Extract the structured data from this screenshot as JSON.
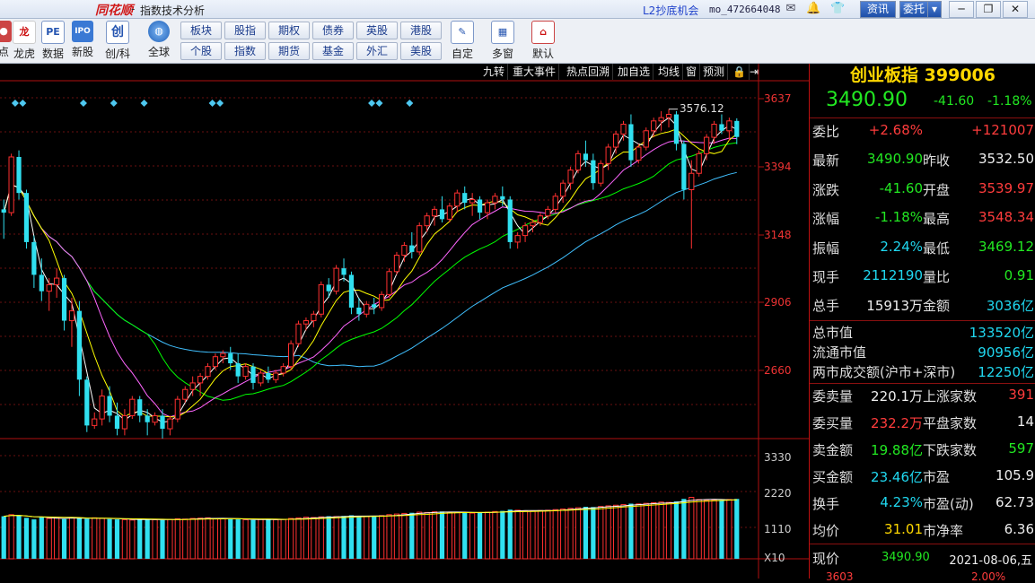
{
  "titlebar": {
    "logo": "同花顺",
    "separator": "-",
    "title": "指数技术分析",
    "promo": "L2抄底机会",
    "user": "mo_472664048",
    "news_btn": "资讯",
    "trade_btn": "委托",
    "trade_arrow": "▾"
  },
  "toolbar": {
    "items": [
      {
        "label": "点",
        "icon": "dot-icon"
      },
      {
        "label": "龙虎",
        "icon": "dragon-tiger-icon"
      },
      {
        "label": "数据",
        "icon": "data-icon",
        "glyph": "PE"
      },
      {
        "label": "新股",
        "icon": "ipo-icon",
        "glyph": "IPO"
      },
      {
        "label": "创/科",
        "icon": "chuang-ke-icon",
        "glyph": "创"
      },
      {
        "label": "全球",
        "icon": "globe-icon"
      },
      {
        "label": "自定",
        "icon": "custom-icon"
      },
      {
        "label": "多窗",
        "icon": "multi-window-icon"
      },
      {
        "label": "默认",
        "icon": "home-icon"
      }
    ],
    "market_buttons": [
      [
        "板块",
        "股指",
        "期权",
        "债券",
        "英股",
        "港股"
      ],
      [
        "个股",
        "指数",
        "期货",
        "基金",
        "外汇",
        "美股"
      ]
    ]
  },
  "chart": {
    "tabs": [
      "九转",
      "重大事件",
      "热点回溯",
      "加自选",
      "均线",
      "窗",
      "预测"
    ],
    "peak_label": "3576.12",
    "price_axis": [
      "3637",
      "3394",
      "3148",
      "2906",
      "2660"
    ],
    "volume_axis": [
      "3330",
      "2220",
      "1110",
      "X10"
    ],
    "colors": {
      "up": "#ff3030",
      "down": "#30e0f0",
      "ma5": "#ffffff",
      "ma10": "#ffff00",
      "ma20": "#ff66ff",
      "ma30": "#00ff00",
      "ma60": "#40c0ff"
    }
  },
  "chart_data": {
    "type": "candlestick",
    "title": "",
    "ylim": [
      2570,
      3660
    ],
    "candles": [
      [
        3270,
        3300,
        3180,
        3260
      ],
      [
        3260,
        3440,
        3250,
        3430
      ],
      [
        3430,
        3450,
        3300,
        3320
      ],
      [
        3320,
        3330,
        3150,
        3170
      ],
      [
        3170,
        3190,
        3030,
        3070
      ],
      [
        3070,
        3120,
        2990,
        3020
      ],
      [
        3020,
        3060,
        2960,
        3040
      ],
      [
        3040,
        3090,
        3000,
        3060
      ],
      [
        3060,
        3070,
        2900,
        2930
      ],
      [
        2930,
        3000,
        2850,
        2960
      ],
      [
        2960,
        2990,
        2700,
        2750
      ],
      [
        2750,
        2760,
        2590,
        2610
      ],
      [
        2610,
        2650,
        2600,
        2630
      ],
      [
        2630,
        2720,
        2610,
        2700
      ],
      [
        2700,
        2730,
        2620,
        2640
      ],
      [
        2640,
        2680,
        2580,
        2600
      ],
      [
        2600,
        2660,
        2580,
        2640
      ],
      [
        2640,
        2700,
        2630,
        2690
      ],
      [
        2690,
        2700,
        2620,
        2640
      ],
      [
        2640,
        2660,
        2580,
        2620
      ],
      [
        2620,
        2650,
        2610,
        2640
      ],
      [
        2640,
        2660,
        2570,
        2600
      ],
      [
        2600,
        2640,
        2580,
        2630
      ],
      [
        2630,
        2700,
        2620,
        2690
      ],
      [
        2690,
        2730,
        2680,
        2720
      ],
      [
        2720,
        2760,
        2700,
        2740
      ],
      [
        2740,
        2770,
        2700,
        2760
      ],
      [
        2760,
        2800,
        2750,
        2790
      ],
      [
        2790,
        2830,
        2780,
        2820
      ],
      [
        2820,
        2840,
        2800,
        2830
      ],
      [
        2830,
        2850,
        2780,
        2800
      ],
      [
        2800,
        2830,
        2740,
        2760
      ],
      [
        2760,
        2800,
        2750,
        2790
      ],
      [
        2790,
        2800,
        2720,
        2740
      ],
      [
        2740,
        2780,
        2730,
        2770
      ],
      [
        2770,
        2790,
        2740,
        2750
      ],
      [
        2750,
        2780,
        2740,
        2770
      ],
      [
        2770,
        2800,
        2760,
        2790
      ],
      [
        2790,
        2870,
        2780,
        2860
      ],
      [
        2860,
        2930,
        2850,
        2920
      ],
      [
        2920,
        2940,
        2900,
        2930
      ],
      [
        2930,
        2960,
        2910,
        2950
      ],
      [
        2950,
        3050,
        2940,
        3040
      ],
      [
        3040,
        3060,
        3000,
        3020
      ],
      [
        3020,
        3100,
        3010,
        3090
      ],
      [
        3090,
        3120,
        3050,
        3070
      ],
      [
        3070,
        3080,
        2950,
        2970
      ],
      [
        2970,
        3000,
        2930,
        2950
      ],
      [
        2950,
        2990,
        2940,
        2980
      ],
      [
        2980,
        3000,
        2950,
        2970
      ],
      [
        2970,
        3020,
        2960,
        3010
      ],
      [
        3010,
        3090,
        3000,
        3080
      ],
      [
        3080,
        3140,
        3070,
        3130
      ],
      [
        3130,
        3170,
        3110,
        3160
      ],
      [
        3160,
        3200,
        3120,
        3140
      ],
      [
        3140,
        3230,
        3130,
        3220
      ],
      [
        3220,
        3260,
        3200,
        3250
      ],
      [
        3250,
        3280,
        3220,
        3270
      ],
      [
        3270,
        3310,
        3230,
        3240
      ],
      [
        3240,
        3290,
        3230,
        3280
      ],
      [
        3280,
        3330,
        3260,
        3320
      ],
      [
        3320,
        3340,
        3270,
        3290
      ],
      [
        3290,
        3320,
        3250,
        3300
      ],
      [
        3300,
        3310,
        3240,
        3260
      ],
      [
        3260,
        3300,
        3240,
        3290
      ],
      [
        3290,
        3320,
        3270,
        3310
      ],
      [
        3310,
        3340,
        3280,
        3300
      ],
      [
        3300,
        3310,
        3150,
        3170
      ],
      [
        3170,
        3200,
        3150,
        3190
      ],
      [
        3190,
        3230,
        3170,
        3220
      ],
      [
        3220,
        3240,
        3200,
        3230
      ],
      [
        3230,
        3260,
        3220,
        3250
      ],
      [
        3250,
        3280,
        3240,
        3270
      ],
      [
        3270,
        3320,
        3260,
        3310
      ],
      [
        3310,
        3360,
        3290,
        3350
      ],
      [
        3350,
        3400,
        3330,
        3390
      ],
      [
        3390,
        3450,
        3380,
        3440
      ],
      [
        3440,
        3480,
        3400,
        3420
      ],
      [
        3420,
        3440,
        3330,
        3350
      ],
      [
        3350,
        3420,
        3340,
        3410
      ],
      [
        3410,
        3470,
        3390,
        3460
      ],
      [
        3460,
        3510,
        3440,
        3500
      ],
      [
        3500,
        3540,
        3480,
        3530
      ],
      [
        3530,
        3560,
        3400,
        3420
      ],
      [
        3420,
        3470,
        3410,
        3460
      ],
      [
        3460,
        3520,
        3450,
        3510
      ],
      [
        3510,
        3550,
        3490,
        3540
      ],
      [
        3540,
        3570,
        3510,
        3550
      ],
      [
        3550,
        3576,
        3520,
        3560
      ],
      [
        3560,
        3570,
        3450,
        3470
      ],
      [
        3470,
        3480,
        3300,
        3330
      ],
      [
        3330,
        3420,
        3150,
        3380
      ],
      [
        3380,
        3450,
        3370,
        3440
      ],
      [
        3440,
        3500,
        3420,
        3490
      ],
      [
        3490,
        3540,
        3470,
        3530
      ],
      [
        3530,
        3560,
        3500,
        3510
      ],
      [
        3510,
        3550,
        3480,
        3540
      ],
      [
        3540,
        3548,
        3469,
        3491
      ]
    ],
    "volume": [
      1350,
      1400,
      1380,
      1300,
      1250,
      1320,
      1280,
      1300,
      1260,
      1310,
      1290,
      1270,
      1300,
      1280,
      1260,
      1250,
      1240,
      1230,
      1260,
      1250,
      1240,
      1230,
      1250,
      1270,
      1260,
      1280,
      1290,
      1300,
      1280,
      1270,
      1260,
      1250,
      1240,
      1230,
      1250,
      1260,
      1240,
      1250,
      1280,
      1300,
      1320,
      1310,
      1330,
      1350,
      1340,
      1360,
      1380,
      1350,
      1340,
      1360,
      1370,
      1400,
      1420,
      1440,
      1460,
      1480,
      1470,
      1490,
      1500,
      1480,
      1470,
      1460,
      1450,
      1470,
      1480,
      1500,
      1520,
      1560,
      1540,
      1520,
      1510,
      1530,
      1540,
      1560,
      1580,
      1600,
      1620,
      1650,
      1640,
      1660,
      1680,
      1700,
      1720,
      1750,
      1740,
      1760,
      1780,
      1800,
      1790,
      1820,
      1900,
      1950,
      1880,
      1850,
      1870,
      1860,
      1880,
      1900
    ],
    "events_x": [
      0.02,
      0.03,
      0.11,
      0.15,
      0.19,
      0.28,
      0.29,
      0.49,
      0.5,
      0.54
    ]
  },
  "quote": {
    "name": "创业板指",
    "code": "399006",
    "last": "3490.90",
    "change": "-41.60",
    "change_pct": "-1.18%",
    "rows": [
      {
        "k1": "委比",
        "v1": "+2.68%",
        "c1": "red",
        "k2": "",
        "v2": "+121007",
        "c2": "red"
      },
      {
        "k1": "最新",
        "v1": "3490.90",
        "c1": "green",
        "k2": "昨收",
        "v2": "3532.50",
        "c2": "white"
      },
      {
        "k1": "涨跌",
        "v1": "-41.60",
        "c1": "green",
        "k2": "开盘",
        "v2": "3539.97",
        "c2": "red"
      },
      {
        "k1": "涨幅",
        "v1": "-1.18%",
        "c1": "green",
        "k2": "最高",
        "v2": "3548.34",
        "c2": "red"
      },
      {
        "k1": "振幅",
        "v1": "2.24%",
        "c1": "cyan",
        "k2": "最低",
        "v2": "3469.12",
        "c2": "green"
      },
      {
        "k1": "现手",
        "v1": "2112190",
        "c1": "cyan",
        "k2": "量比",
        "v2": "0.91",
        "c2": "green"
      },
      {
        "k1": "总手",
        "v1": "15913万",
        "c1": "white",
        "k2": "金额",
        "v2": "3036亿",
        "c2": "cyan"
      }
    ],
    "market_cap": [
      {
        "k": "总市值",
        "v": "133520亿"
      },
      {
        "k": "流通市值",
        "v": "90956亿"
      },
      {
        "k": "两市成交额(沪市+深市)",
        "v": "12250亿"
      }
    ],
    "rows2": [
      {
        "k1": "委卖量",
        "v1": "220.1万",
        "c1": "white",
        "k2": "上涨家数",
        "v2": "391",
        "c2": "red"
      },
      {
        "k1": "委买量",
        "v1": "232.2万",
        "c1": "red",
        "k2": "平盘家数",
        "v2": "14",
        "c2": "white"
      },
      {
        "k1": "卖金额",
        "v1": "19.88亿",
        "c1": "green",
        "k2": "下跌家数",
        "v2": "597",
        "c2": "green"
      },
      {
        "k1": "买金额",
        "v1": "23.46亿",
        "c1": "cyan",
        "k2": "市盈",
        "v2": "105.9",
        "c2": "white"
      },
      {
        "k1": "换手",
        "v1": "4.23%",
        "c1": "cyan",
        "k2": "市盈(动)",
        "v2": "62.73",
        "c2": "white"
      },
      {
        "k1": "均价",
        "v1": "31.01",
        "c1": "yellow",
        "k2": "市净率",
        "v2": "6.36",
        "c2": "white"
      }
    ],
    "footer": {
      "label": "现价",
      "price": "3490.90",
      "date": "2021-08-06,五",
      "partial_left": "3603",
      "partial_right": "2.00%"
    }
  }
}
